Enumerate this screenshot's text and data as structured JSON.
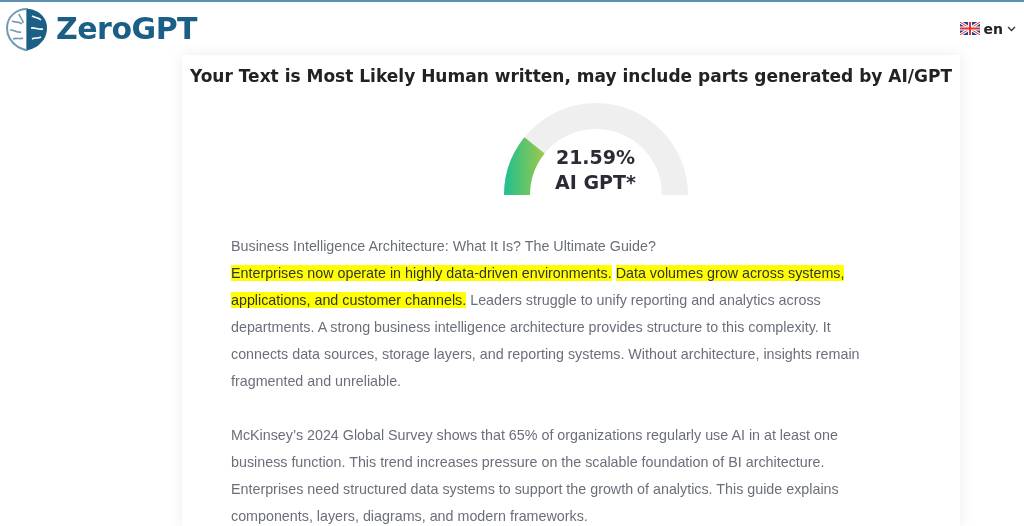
{
  "header": {
    "logo_text": "ZeroGPT",
    "language": "en"
  },
  "result": {
    "title": "Your Text is Most Likely Human written, may include parts generated by AI/GPT",
    "gauge": {
      "level": 0.2159,
      "percentage": "21.59%",
      "label": "AI GPT*"
    }
  },
  "text_heading": "Business Intelligence Architecture: What It Is? The Ultimate Guide?",
  "paragraphs": [
    {
      "segments": [
        {
          "text": "Enterprises now operate in highly data-driven environments.",
          "highlighted": true
        },
        {
          "text": "Data volumes grow across systems, applications, and customer channels.",
          "highlighted": true
        },
        {
          "text": " Leaders struggle to unify reporting and analytics across departments. A strong business intelligence architecture provides structure to this complexity. It connects data sources, storage layers, and reporting systems. Without architecture, insights remain fragmented and unreliable.",
          "highlighted": false
        }
      ]
    },
    {
      "segments": [
        {
          "text": "McKinsey’s 2024 Global Survey shows that 65% of organizations regularly use AI in at least one business function. This trend increases pressure on the scalable foundation of BI architecture. Enterprises need structured data systems to support the growth of analytics. This guide explains components, layers, diagrams, and modern frameworks.",
          "highlighted": false
        }
      ]
    }
  ]
}
